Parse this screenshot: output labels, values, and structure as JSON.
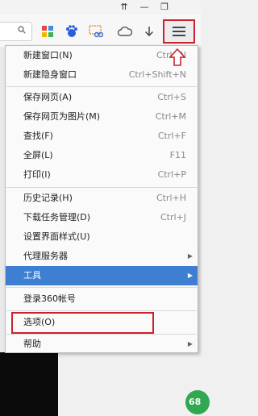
{
  "window_controls": {
    "pin": "⇈",
    "minimize": "—",
    "restore": "❐"
  },
  "toolbar": {
    "search_icon": "search-icon",
    "icons": [
      "app-grid-icon",
      "baidu-paw-icon",
      "screenshot-scissors-icon",
      "cloud-icon",
      "download-arrow-icon",
      "menu-icon"
    ]
  },
  "menu": {
    "items": [
      {
        "label": "新建窗口(N)",
        "shortcut": "Ctrl+N"
      },
      {
        "label": "新建隐身窗口",
        "shortcut": "Ctrl+Shift+N"
      },
      {
        "label": "保存网页(A)",
        "shortcut": "Ctrl+S"
      },
      {
        "label": "保存网页为图片(M)",
        "shortcut": "Ctrl+M"
      },
      {
        "label": "查找(F)",
        "shortcut": "Ctrl+F"
      },
      {
        "label": "全屏(L)",
        "shortcut": "F11"
      },
      {
        "label": "打印(I)",
        "shortcut": "Ctrl+P"
      },
      {
        "label": "历史记录(H)",
        "shortcut": "Ctrl+H"
      },
      {
        "label": "下载任务管理(D)",
        "shortcut": "Ctrl+J"
      },
      {
        "label": "设置界面样式(U)",
        "shortcut": ""
      },
      {
        "label": "代理服务器",
        "shortcut": ""
      },
      {
        "label": "工具",
        "shortcut": ""
      },
      {
        "label": "登录360帐号",
        "shortcut": ""
      },
      {
        "label": "选项(O)",
        "shortcut": ""
      },
      {
        "label": "帮助",
        "shortcut": ""
      }
    ]
  },
  "badge": "68",
  "colors": {
    "highlight_red": "#c8232c",
    "active_blue": "#3f7fd1"
  }
}
